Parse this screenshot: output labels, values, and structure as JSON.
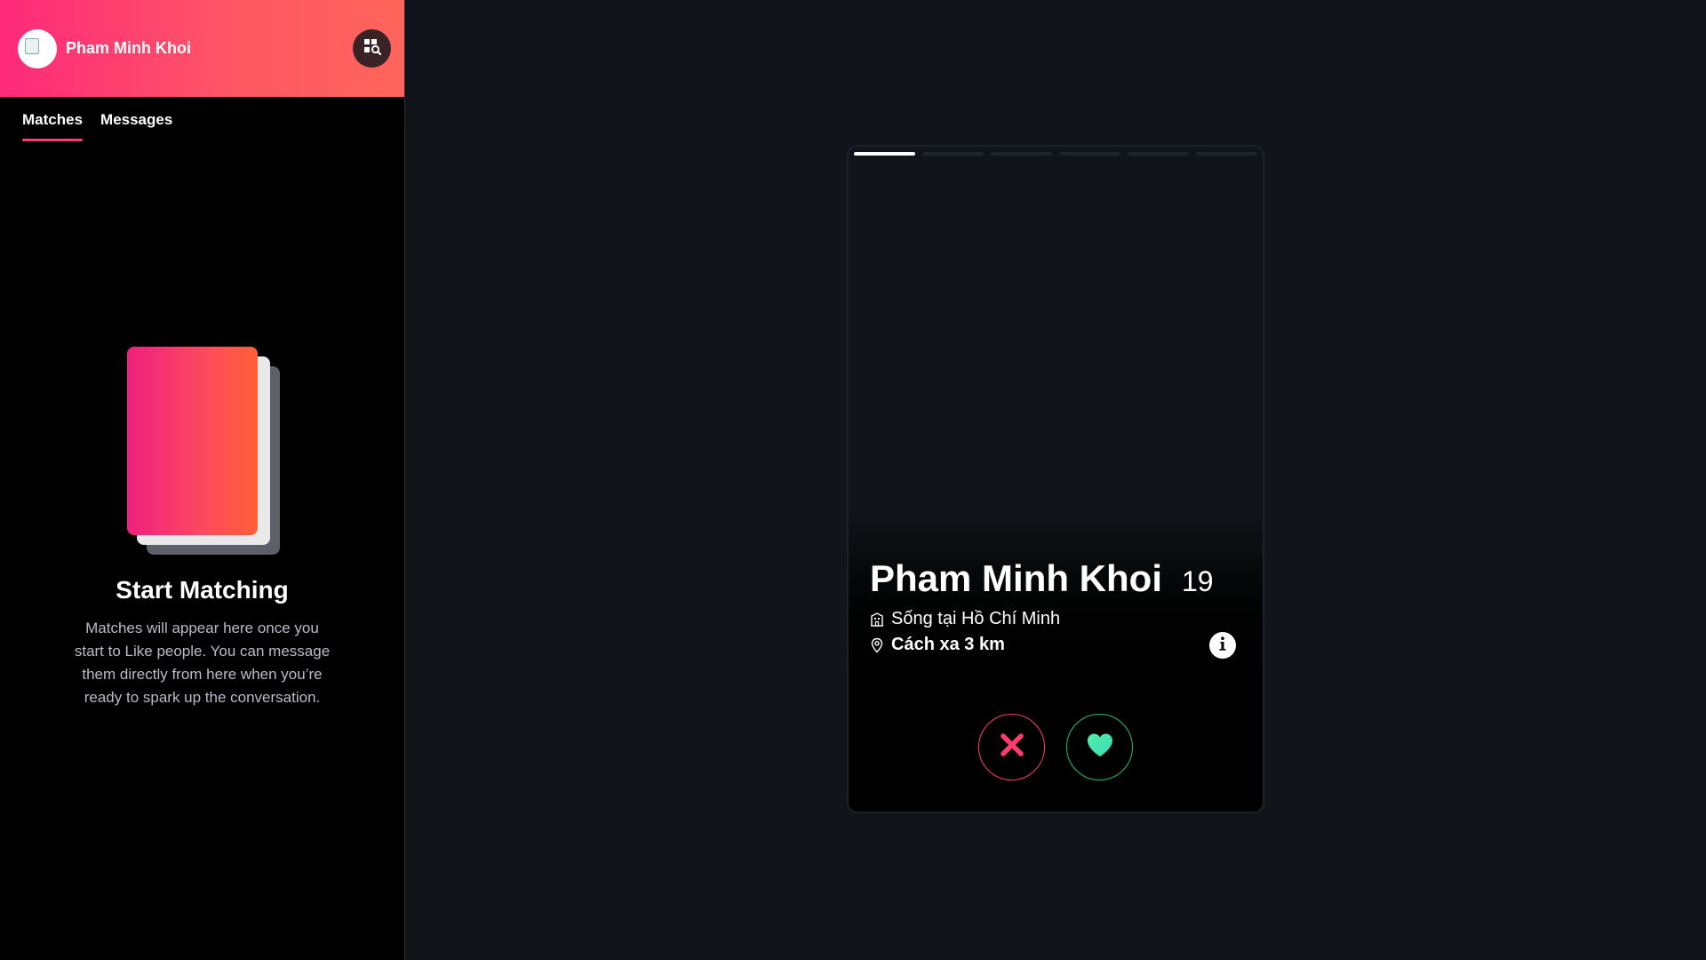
{
  "sidebar": {
    "user_name": "Pham Minh Khoi",
    "tabs": [
      {
        "label": "Matches",
        "active": true
      },
      {
        "label": "Messages",
        "active": false
      }
    ],
    "empty_state": {
      "title": "Start Matching",
      "description": "Matches will appear here once you start to Like people. You can message them directly from here when you’re ready to spark up the conversation."
    }
  },
  "card": {
    "name": "Pham Minh Khoi",
    "age": "19",
    "lives_in": "Sống tại Hồ Chí Minh",
    "distance": "Cách xa 3 km",
    "photo_count": 6,
    "current_photo": 1
  },
  "colors": {
    "brand_gradient_start": "#fd297b",
    "brand_gradient_end": "#ff655b",
    "nope": "#fd3c6d",
    "like": "#4be3a6",
    "background": "#111418"
  },
  "icons": {
    "explore": "explore-search-icon",
    "home": "building-icon",
    "location": "location-pin-icon",
    "info": "info-icon",
    "nope": "close-icon",
    "like": "heart-icon"
  }
}
